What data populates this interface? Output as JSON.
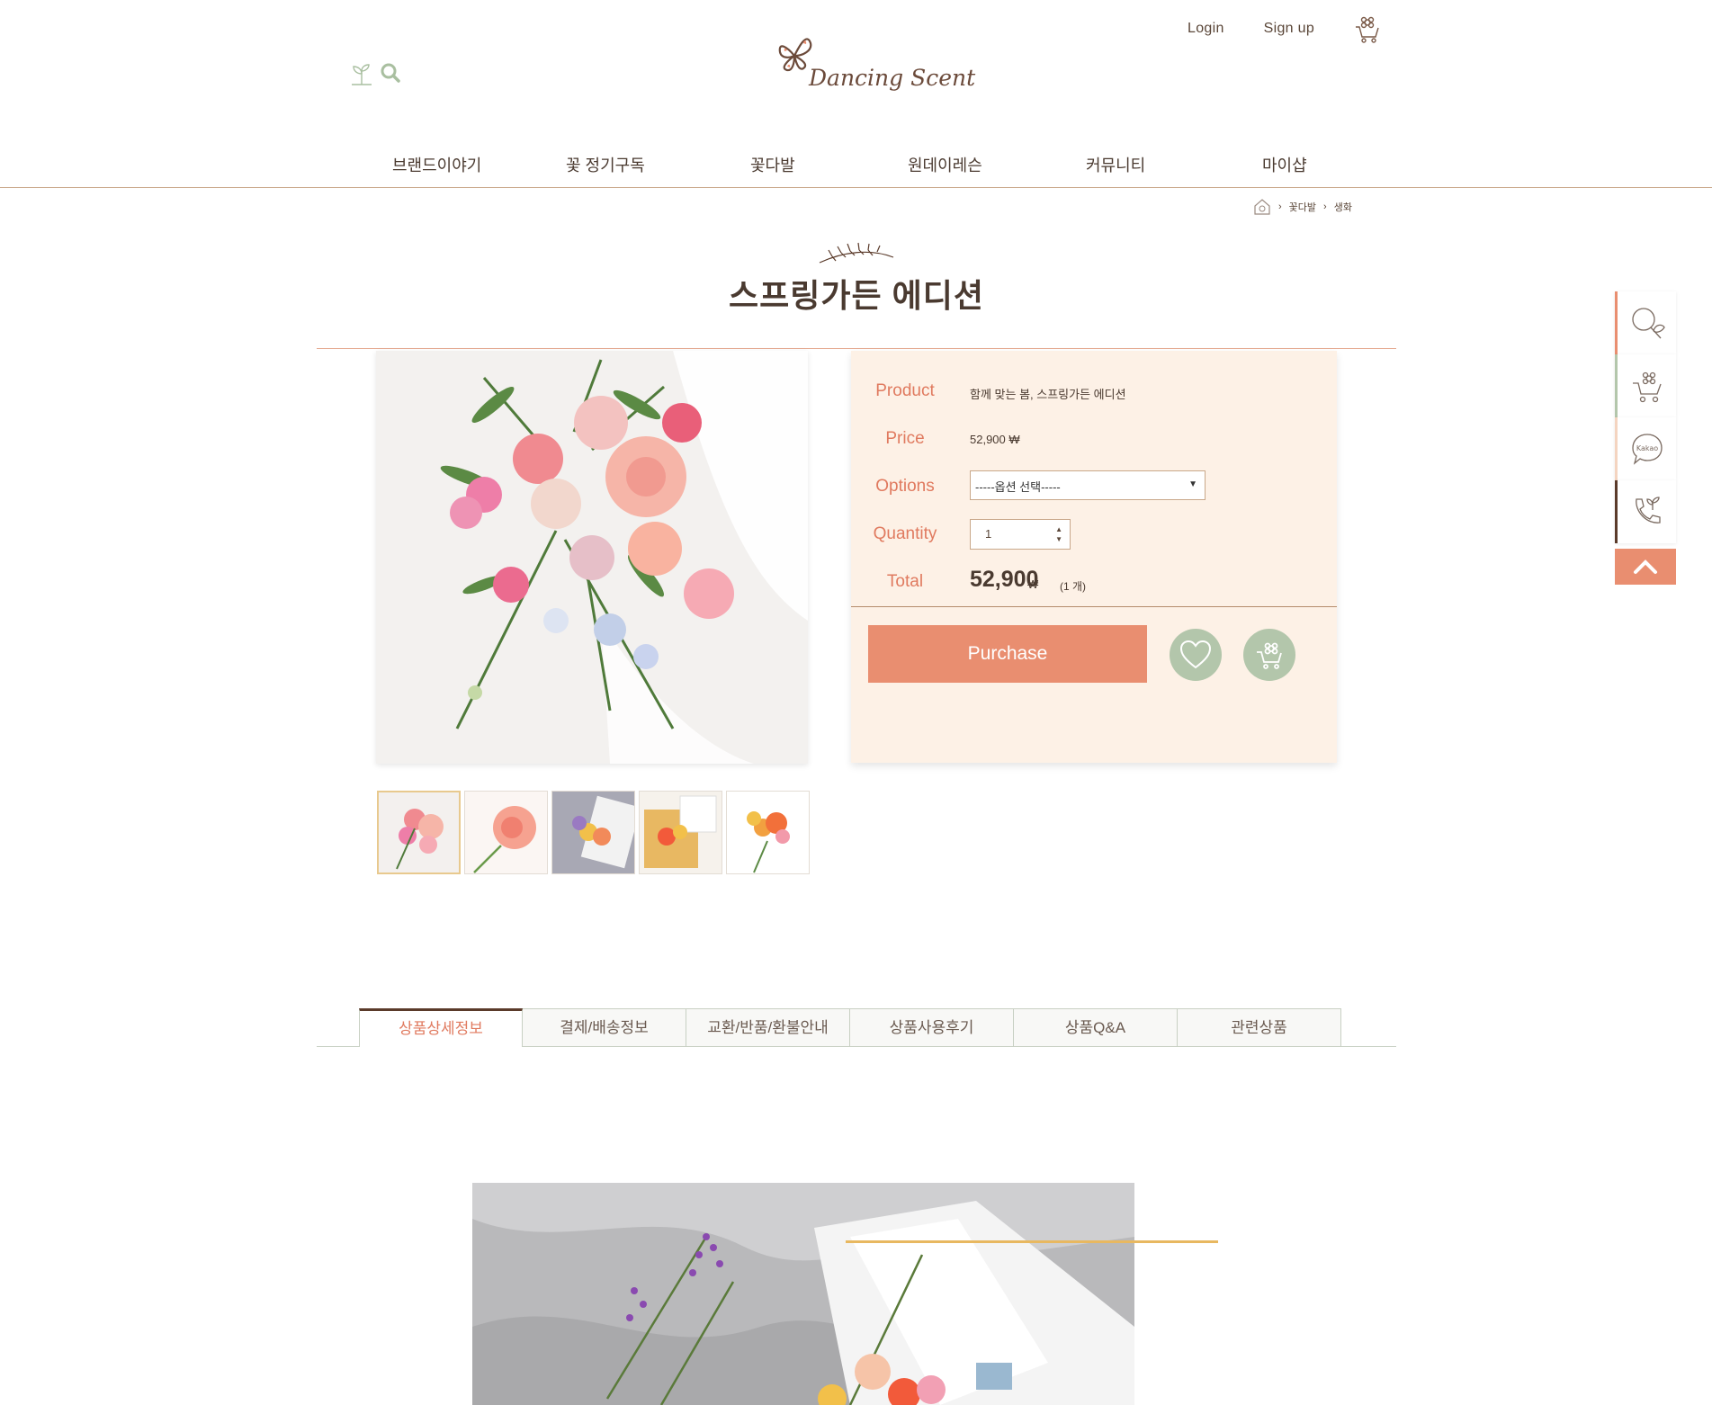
{
  "header": {
    "login_label": "Login",
    "signup_label": "Sign up",
    "logo_text": "Dancing Scent",
    "cart_icon": "flower-cart-icon",
    "search_icon": "search-icon",
    "sprout_icon": "sprout-icon"
  },
  "nav": {
    "items": [
      "브랜드이야기",
      "꽃 정기구독",
      "꽃다발",
      "원데이레슨",
      "커뮤니티",
      "마이샵"
    ]
  },
  "breadcrumb": {
    "home_icon": "home-icon",
    "items": [
      "꽃다발",
      "생화"
    ]
  },
  "page": {
    "title": "스프링가든 에디션"
  },
  "product": {
    "labels": {
      "product": "Product",
      "price": "Price",
      "options": "Options",
      "quantity": "Quantity",
      "total": "Total"
    },
    "name": "함께 맞는 봄, 스프링가든 에디션",
    "price": "52,900 ₩",
    "option_selected": "-----옵션 선택-----",
    "quantity": "1",
    "total_value": "52,900",
    "total_currency": "₩",
    "total_count": "(1 개)",
    "purchase_label": "Purchase",
    "wishlist_icon": "heart-icon",
    "cart_icon": "flower-cart-icon",
    "thumbnail_count": 5
  },
  "quick_menu": {
    "items": [
      {
        "icon": "search-leaf-icon",
        "color": "#e98e70"
      },
      {
        "icon": "flower-cart-icon",
        "color": "#b3c6ab"
      },
      {
        "icon": "kakao-icon",
        "label": "Kakao",
        "color": "#f4d4c0"
      },
      {
        "icon": "phone-leaf-icon",
        "color": "#5a3a2a"
      }
    ],
    "top_icon": "chevron-up-icon"
  },
  "tabs": {
    "items": [
      "상품상세정보",
      "결제/배송정보",
      "교환/반품/환불안내",
      "상품사용후기",
      "상품Q&A",
      "관련상품"
    ],
    "active_index": 0
  },
  "colors": {
    "accent": "#e98e70",
    "panel_bg": "#fdf1e6",
    "sage": "#b3c6ab",
    "brown": "#5a3a2a",
    "gold": "#e8b860"
  }
}
